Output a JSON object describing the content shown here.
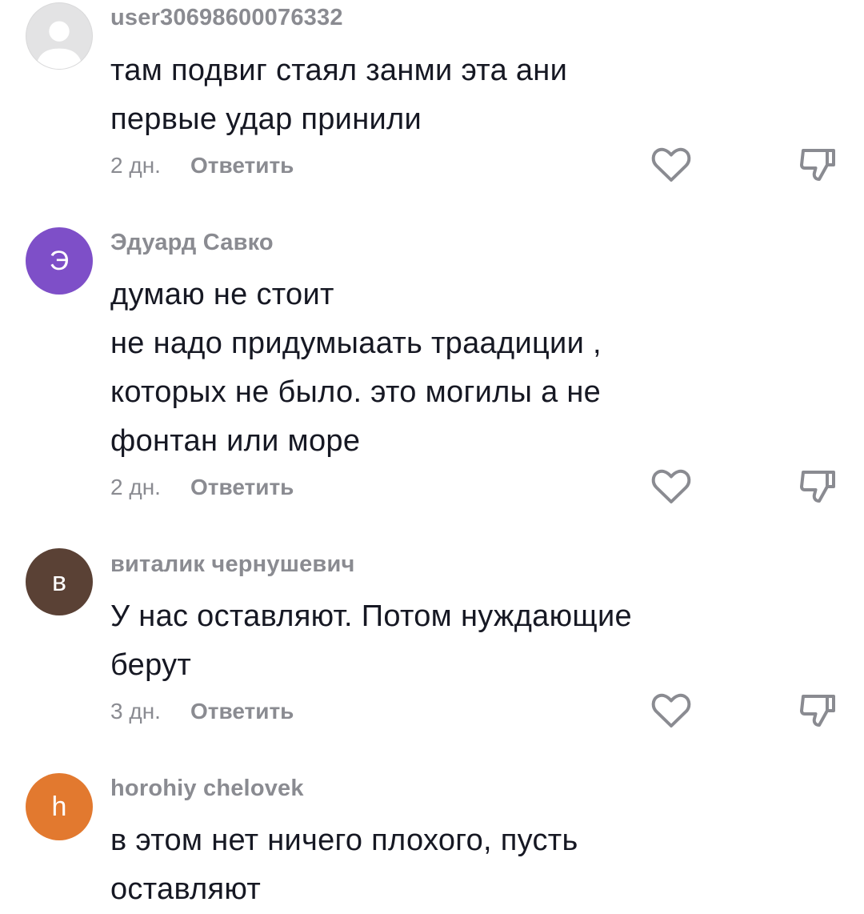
{
  "comments": [
    {
      "username": "user30698600076332",
      "avatar_letter": "",
      "avatar_icon": "default-user-icon",
      "avatar_color": "#e3e3e4",
      "lines": [
        "там подвиг стаял занми эта ани",
        "первые удар принили"
      ],
      "time": "2 дн.",
      "reply_label": "Ответить"
    },
    {
      "username": "Эдуард Савко",
      "avatar_letter": "Э",
      "avatar_color": "#7e4fc8",
      "lines": [
        "думаю не стоит",
        "не надо придумыаать траадиции ,",
        "которых не было. это могилы а не",
        "фонтан или море"
      ],
      "time": "2 дн.",
      "reply_label": "Ответить"
    },
    {
      "username": "виталик чернушевич",
      "avatar_letter": "в",
      "avatar_color": "#5a4135",
      "lines": [
        "У нас оставляют. Потом нуждающие",
        "берут"
      ],
      "time": "3 дн.",
      "reply_label": "Ответить"
    },
    {
      "username": "horohiy chelovek",
      "avatar_letter": "h",
      "avatar_color": "#e2792f",
      "lines": [
        "в этом нет ничего плохого, пусть",
        "оставляют"
      ],
      "time": "",
      "reply_label": ""
    }
  ],
  "icons": {
    "like": "heart-outline-icon",
    "dislike": "thumbs-down-outline-icon"
  }
}
